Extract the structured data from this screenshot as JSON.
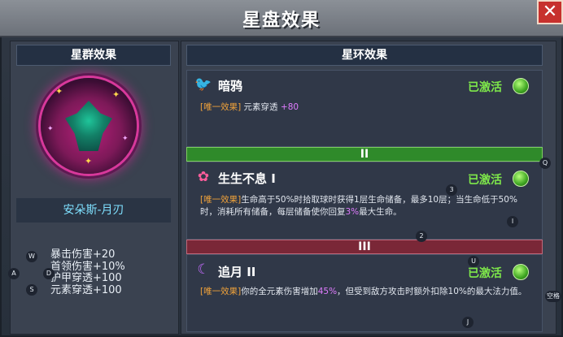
{
  "window": {
    "title": "星盘效果",
    "close_label": "✕"
  },
  "left": {
    "header": "星群效果",
    "constellation": "安朵斯-月刃",
    "stats": [
      "暴击伤害+20",
      "首领伤害+10%",
      "护甲穿透+100",
      "元素穿透+100"
    ]
  },
  "right": {
    "header": "星环效果",
    "slots": [
      {
        "icon": "crow-icon",
        "name": "暗鸦",
        "status": "已激活",
        "tag": "[唯一效果]",
        "desc_pre": "元素穿透 ",
        "desc_hl": "+80",
        "desc_post": ""
      },
      {
        "icon": "flower-icon",
        "name": "生生不息 I",
        "status": "已激活",
        "tag": "[唯一效果]",
        "desc_pre": "生命高于50%时拾取球时获得1层生命储备，最多10层；当生命低于50%时，消耗所有储备，每层储备使你回复",
        "desc_hl": "3%",
        "desc_post": "最大生命。"
      },
      {
        "icon": "crescent-moon-icon",
        "name": "追月 II",
        "status": "已激活",
        "tag": "[唯一效果]",
        "desc_pre": "你的全元素伤害增加",
        "desc_hl": "45%",
        "desc_post": "，但受到敌方攻击时额外扣除10%的最大法力值。"
      }
    ],
    "tiers": [
      "II",
      "III"
    ]
  },
  "key_hints": [
    "W",
    "A",
    "D",
    "S",
    "Q",
    "3",
    "I",
    "2",
    "U",
    "J",
    "空格"
  ],
  "colors": {
    "activated": "#7ee84a",
    "tag": "#f0a23a",
    "highlight": "#e07cff",
    "tier_green": "#2f8a2a",
    "tier_red": "#7a2737"
  }
}
